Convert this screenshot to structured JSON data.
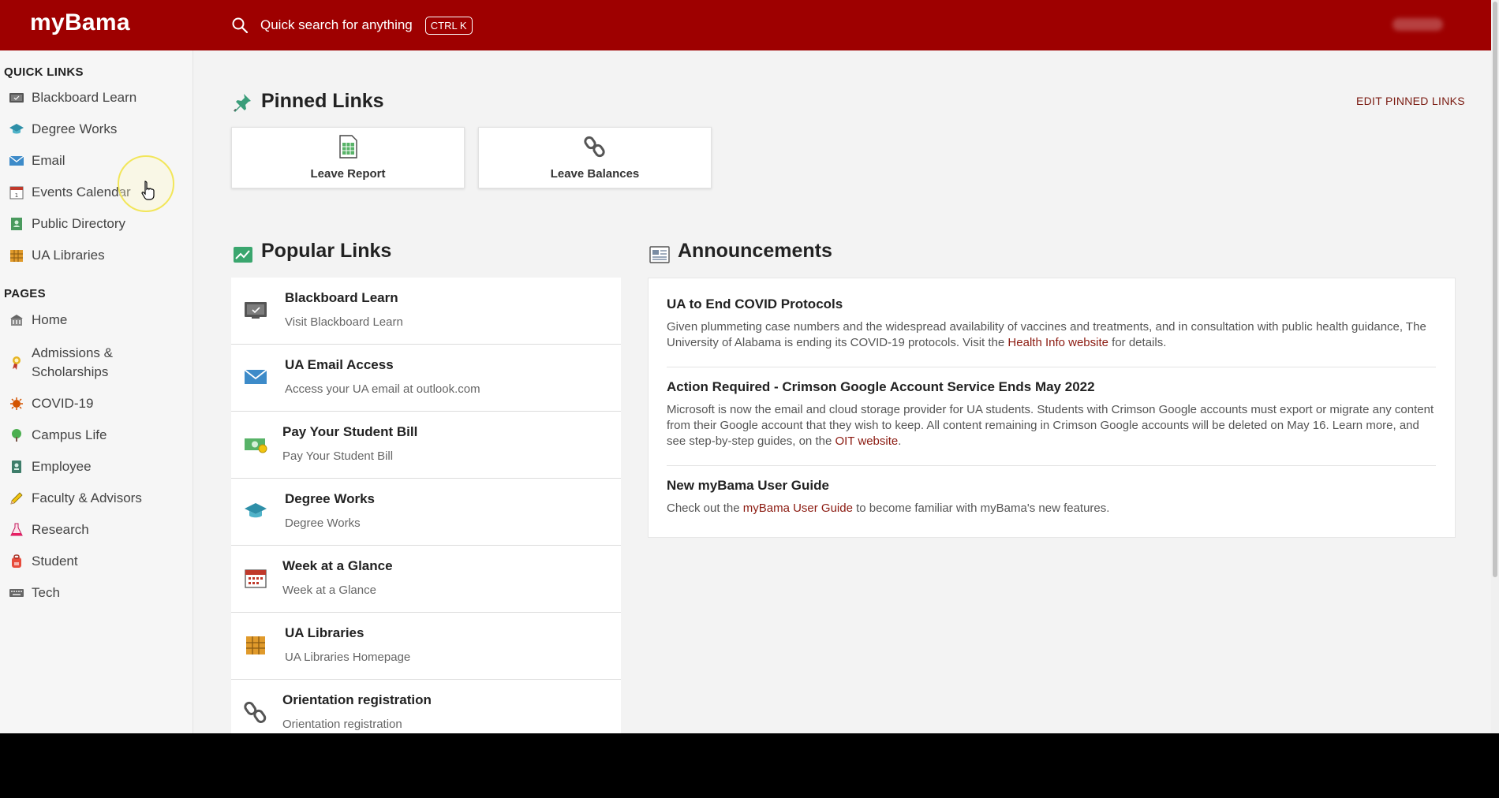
{
  "header": {
    "logo": "myBama",
    "search_placeholder": "Quick search for anything",
    "shortcut": "CTRL K"
  },
  "sidebar": {
    "quick_links_title": "QUICK LINKS",
    "quick_links": [
      {
        "label": "Blackboard Learn",
        "icon": "monitor-icon"
      },
      {
        "label": "Degree Works",
        "icon": "graduation-cap-icon"
      },
      {
        "label": "Email",
        "icon": "envelope-icon"
      },
      {
        "label": "Events Calendar",
        "icon": "calendar-icon"
      },
      {
        "label": "Public Directory",
        "icon": "contact-book-icon"
      },
      {
        "label": "UA Libraries",
        "icon": "bookshelf-icon"
      }
    ],
    "pages_title": "PAGES",
    "pages": [
      {
        "label": "Home",
        "icon": "building-icon"
      },
      {
        "label": "Admissions & Scholarships",
        "icon": "award-ribbon-icon"
      },
      {
        "label": "COVID-19",
        "icon": "virus-icon"
      },
      {
        "label": "Campus Life",
        "icon": "tree-icon"
      },
      {
        "label": "Employee",
        "icon": "id-badge-icon"
      },
      {
        "label": "Faculty & Advisors",
        "icon": "pencil-icon"
      },
      {
        "label": "Research",
        "icon": "flask-icon"
      },
      {
        "label": "Student",
        "icon": "backpack-icon"
      },
      {
        "label": "Tech",
        "icon": "keyboard-icon"
      }
    ]
  },
  "pinned": {
    "title": "Pinned Links",
    "edit_label": "EDIT PINNED LINKS",
    "items": [
      {
        "label": "Leave Report",
        "icon": "spreadsheet-icon"
      },
      {
        "label": "Leave Balances",
        "icon": "chain-link-icon"
      }
    ]
  },
  "popular": {
    "title": "Popular Links",
    "items": [
      {
        "title": "Blackboard Learn",
        "subtitle": "Visit Blackboard Learn",
        "icon": "monitor-icon"
      },
      {
        "title": "UA Email Access",
        "subtitle": "Access your UA email at outlook.com",
        "icon": "envelope-icon"
      },
      {
        "title": "Pay Your Student Bill",
        "subtitle": "Pay Your Student Bill",
        "icon": "money-icon"
      },
      {
        "title": "Degree Works",
        "subtitle": "Degree Works",
        "icon": "graduation-cap-icon"
      },
      {
        "title": "Week at a Glance",
        "subtitle": "Week at a Glance",
        "icon": "calendar-icon"
      },
      {
        "title": "UA Libraries",
        "subtitle": "UA Libraries Homepage",
        "icon": "bookshelf-icon"
      },
      {
        "title": "Orientation registration",
        "subtitle": "Orientation registration",
        "icon": "chain-link-icon"
      }
    ]
  },
  "announcements": {
    "title": "Announcements",
    "items": [
      {
        "title": "UA to End COVID Protocols",
        "body_before": "Given plummeting case numbers and the widespread availability of vaccines and treatments, and in consultation with public health guidance, The University of Alabama is ending its COVID-19 protocols. Visit the ",
        "link": "Health Info website",
        "body_after": " for details."
      },
      {
        "title": "Action Required - Crimson Google Account Service Ends May 2022",
        "body_before": "Microsoft is now the email and cloud storage provider for UA students. Students with Crimson Google accounts must export or migrate any content from their Google account that they wish to keep. All content remaining in Crimson Google accounts will be deleted on May 16. Learn more, and see step-by-step guides, on the ",
        "link": "OIT website",
        "body_after": "."
      },
      {
        "title": "New myBama User Guide",
        "body_before": "Check out the ",
        "link": "myBama User Guide",
        "body_after": " to become familiar with myBama's new features."
      }
    ]
  },
  "colors": {
    "brand_red": "#9e0000",
    "link_red": "#8b1a10"
  }
}
